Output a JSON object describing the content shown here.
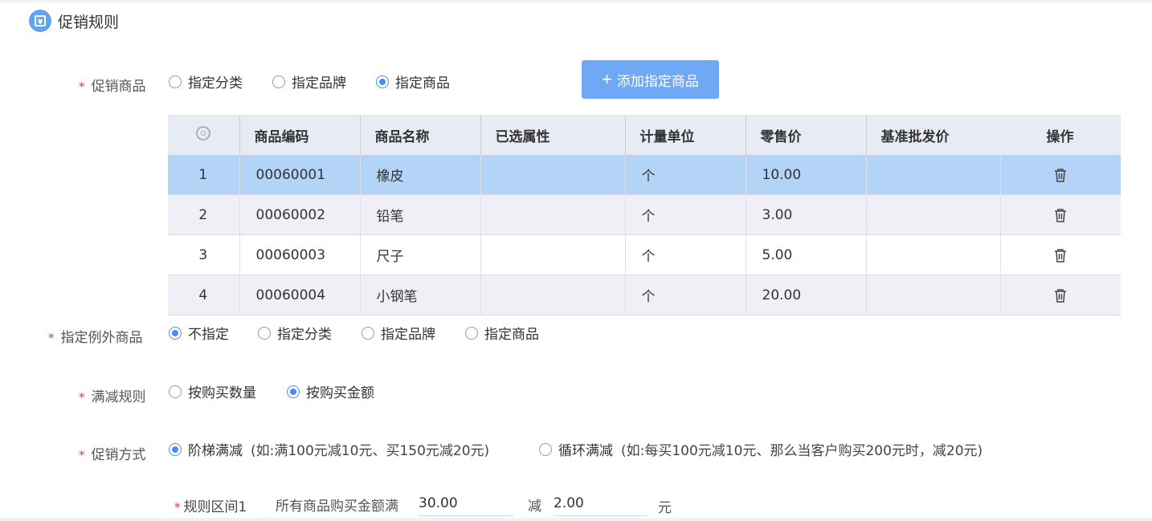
{
  "section": {
    "title": "促销规则",
    "icon": "yen-receipt-icon"
  },
  "promo_goods": {
    "label": "促销商品",
    "options": [
      {
        "label": "指定分类",
        "checked": false
      },
      {
        "label": "指定品牌",
        "checked": false
      },
      {
        "label": "指定商品",
        "checked": true
      }
    ],
    "add_button": "添加指定商品"
  },
  "table": {
    "columns": [
      "商品编码",
      "商品名称",
      "已选属性",
      "计量单位",
      "零售价",
      "基准批发价",
      "操作"
    ],
    "rows": [
      {
        "no": "1",
        "code": "00060001",
        "name": "橡皮",
        "attr": "",
        "unit": "个",
        "price": "10.00",
        "wholesale": ""
      },
      {
        "no": "2",
        "code": "00060002",
        "name": "铅笔",
        "attr": "",
        "unit": "个",
        "price": "3.00",
        "wholesale": ""
      },
      {
        "no": "3",
        "code": "00060003",
        "name": "尺子",
        "attr": "",
        "unit": "个",
        "price": "5.00",
        "wholesale": ""
      },
      {
        "no": "4",
        "code": "00060004",
        "name": "小钢笔",
        "attr": "",
        "unit": "个",
        "price": "20.00",
        "wholesale": ""
      }
    ]
  },
  "exception_goods": {
    "label": "指定例外商品",
    "options": [
      {
        "label": "不指定",
        "checked": true
      },
      {
        "label": "指定分类",
        "checked": false
      },
      {
        "label": "指定品牌",
        "checked": false
      },
      {
        "label": "指定商品",
        "checked": false
      }
    ]
  },
  "discount_rule": {
    "label": "满减规则",
    "options": [
      {
        "label": "按购买数量",
        "checked": false
      },
      {
        "label": "按购买金额",
        "checked": true
      }
    ]
  },
  "promo_method": {
    "label": "促销方式",
    "options": [
      {
        "label": "阶梯满减",
        "hint": "(如:满100元减10元、买150元减20元)",
        "checked": true
      },
      {
        "label": "循环满减",
        "hint": "(如:每买100元减10元、那么当客户购买200元时，减20元)",
        "checked": false
      }
    ]
  },
  "rule_range": {
    "label": "规则区间1",
    "prefix": "所有商品购买金额满",
    "threshold": "30.00",
    "minus_label": "减",
    "discount": "2.00",
    "unit": "元"
  },
  "colors": {
    "accent": "#4a8ff0",
    "button": "#6fa8f4",
    "selected_row": "#b3d3f7",
    "required": "#e23b3b"
  }
}
